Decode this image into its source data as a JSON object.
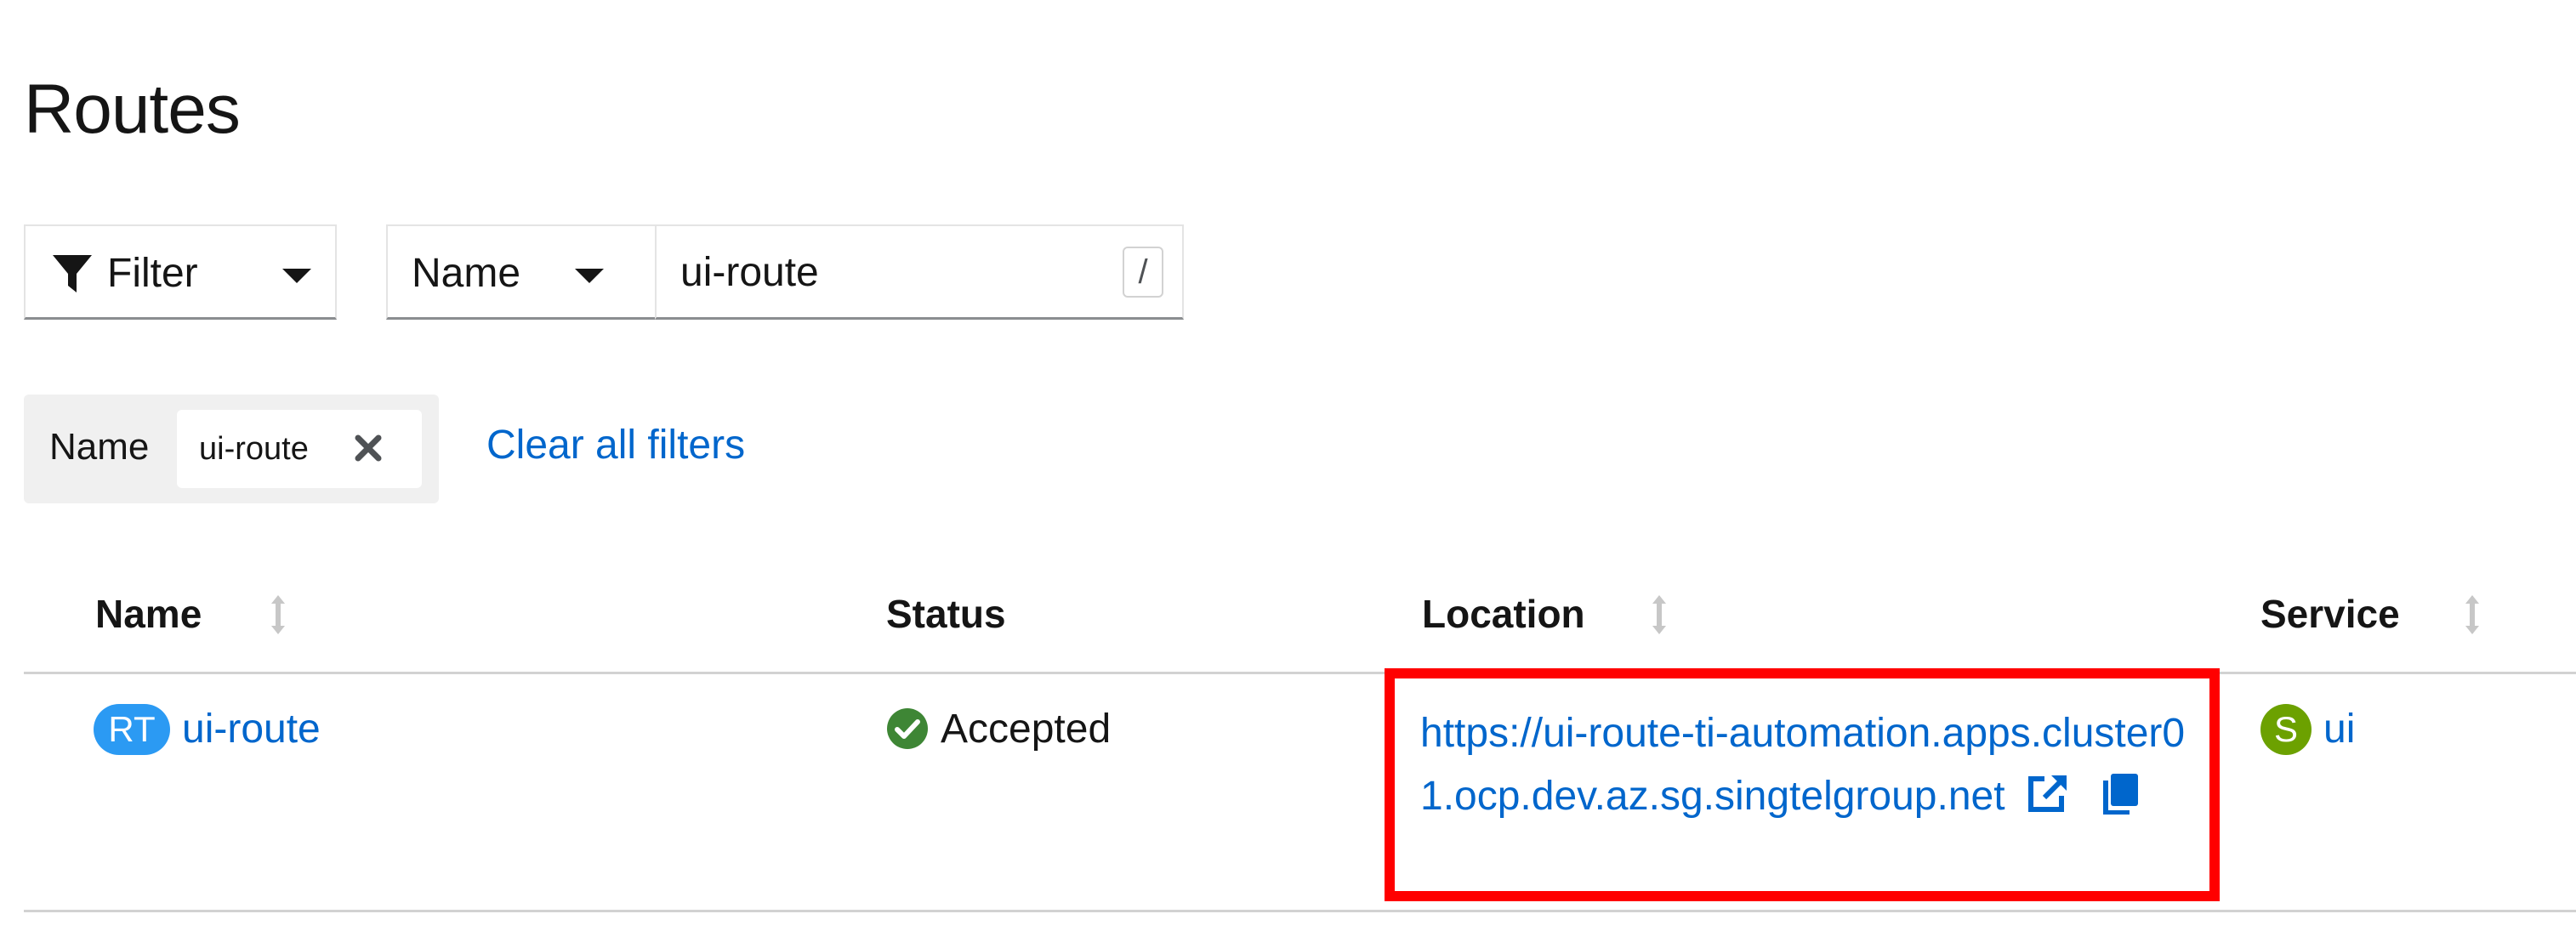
{
  "page": {
    "title": "Routes"
  },
  "toolbar": {
    "filter_label": "Filter",
    "attribute_label": "Name",
    "search_value": "ui-route",
    "search_shortcut": "/"
  },
  "chips": {
    "category": "Name",
    "chip_value": "ui-route",
    "clear_all": "Clear all filters"
  },
  "table": {
    "columns": [
      "Name",
      "Status",
      "Location",
      "Service"
    ],
    "rows": [
      {
        "name_badge": "RT",
        "name": "ui-route",
        "status": "Accepted",
        "location": "https://ui-route-ti-automation.apps.cluster01.ocp.dev.az.sg.singtelgroup.net",
        "service_badge": "S",
        "service": "ui"
      }
    ]
  },
  "colors": {
    "link": "#0066cc",
    "route_badge": "#2b9af3",
    "service_badge": "#6ca100",
    "status_success": "#3e8635",
    "highlight": "#ff0000"
  },
  "icons": [
    "filter-icon",
    "caret-down-icon",
    "close-icon",
    "sort-icon",
    "check-circle-icon",
    "external-link-icon",
    "copy-icon"
  ]
}
